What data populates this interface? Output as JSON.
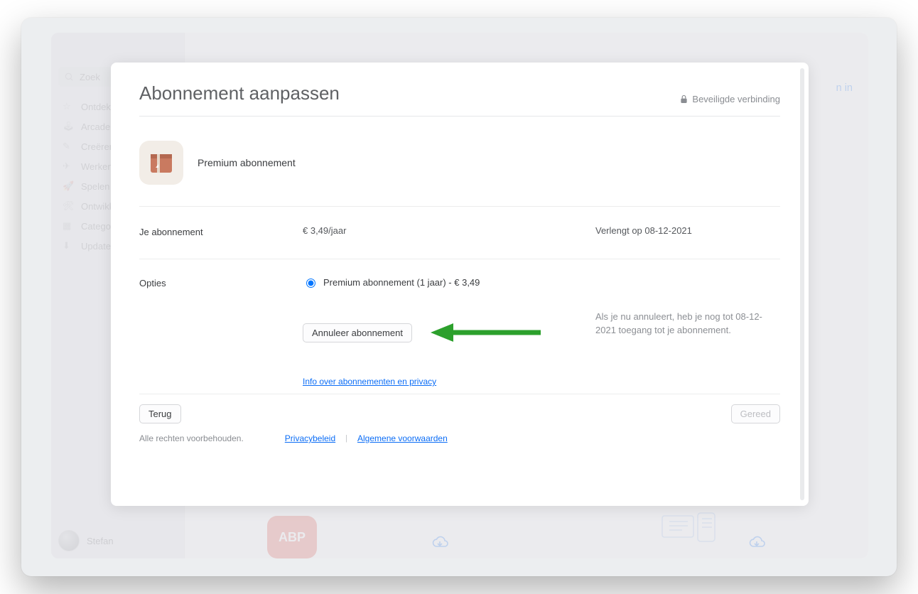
{
  "window": {
    "search_placeholder": "Zoek",
    "login_fragment": "n in",
    "user_name": "Stefan",
    "abp_label": "ABP"
  },
  "sidebar": {
    "items": [
      {
        "label": "Ontdek"
      },
      {
        "label": "Arcade"
      },
      {
        "label": "Creëren"
      },
      {
        "label": "Werken"
      },
      {
        "label": "Spelen"
      },
      {
        "label": "Ontwikkelen"
      },
      {
        "label": "Categorieën"
      },
      {
        "label": "Updates"
      }
    ]
  },
  "modal": {
    "title": "Abonnement aanpassen",
    "secure_label": "Beveiligde verbinding",
    "product_name": "Premium abonnement",
    "section_subscription_label": "Je abonnement",
    "price": "€ 3,49/jaar",
    "renewal": "Verlengt op 08-12-2021",
    "section_options_label": "Opties",
    "option_label": "Premium abonnement (1 jaar) - € 3,49",
    "cancel_button": "Annuleer abonnement",
    "cancel_note": "Als je nu annuleert, heb je nog tot 08-12-2021 toegang tot je abonnement.",
    "privacy_link": "Info over abonnementen en privacy",
    "back_button": "Terug",
    "done_button": "Gereed",
    "rights": "Alle rechten voorbehouden.",
    "privacy_policy": "Privacybeleid",
    "terms": "Algemene voorwaarden"
  }
}
